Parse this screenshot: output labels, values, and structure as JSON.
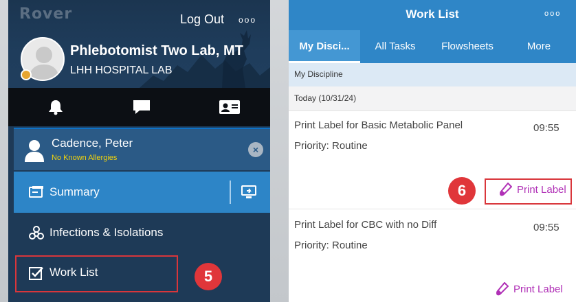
{
  "left": {
    "logo": "Rover",
    "logout_label": "Log Out",
    "more_icon": "ooo",
    "user": {
      "name": "Phlebotomist Two Lab, MT",
      "department": "LHH HOSPITAL LAB"
    },
    "icon_bar": [
      "bell-icon",
      "chat-icon",
      "id-card-icon"
    ],
    "patient": {
      "name": "Cadence, Peter",
      "allergies": "No Known Allergies",
      "close_icon": "×"
    },
    "menu": {
      "summary": "Summary",
      "infections": "Infections & Isolations",
      "worklist": "Work List"
    },
    "step_badge": "5"
  },
  "right": {
    "title": "Work List",
    "more_icon": "ooo",
    "tabs": [
      "My Disci...",
      "All Tasks",
      "Flowsheets",
      "More"
    ],
    "section": "My Discipline",
    "date": "Today (10/31/24)",
    "tasks": [
      {
        "title": "Print Label for Basic Metabolic Panel",
        "priority": "Priority: Routine",
        "time": "09:55",
        "action": "Print Label"
      },
      {
        "title": "Print Label for CBC with no Diff",
        "priority": "Priority: Routine",
        "time": "09:55",
        "action": "Print Label"
      }
    ],
    "step_badge": "6"
  },
  "colors": {
    "header_blue": "#2f86c7",
    "left_bg": "#1e3a57",
    "accent_purple": "#b030b6",
    "annotation_red": "#d9363b",
    "allergy_yellow": "#f2d30b"
  }
}
